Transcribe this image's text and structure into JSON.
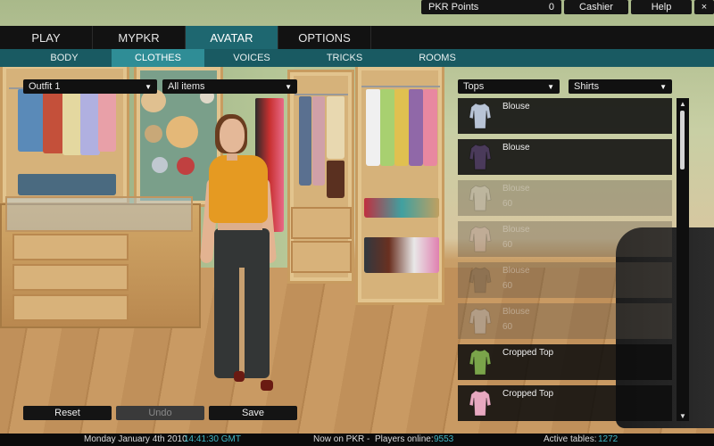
{
  "topbar": {
    "points_label": "PKR Points",
    "points_value": "0",
    "cashier_label": "Cashier",
    "help_label": "Help",
    "close_symbol": "×"
  },
  "main_tabs": [
    "PLAY",
    "MYPKR",
    "AVATAR",
    "OPTIONS"
  ],
  "active_main_tab": "AVATAR",
  "sub_tabs": [
    "BODY",
    "CLOTHES",
    "VOICES",
    "TRICKS",
    "ROOMS"
  ],
  "active_sub_tab": "CLOTHES",
  "filters": {
    "outfit": "Outfit 1",
    "items": "All items",
    "category": "Tops",
    "subcategory": "Shirts"
  },
  "items": [
    {
      "name": "Blouse",
      "price": "",
      "color": "#b8c4d6",
      "locked": false
    },
    {
      "name": "Blouse",
      "price": "",
      "color": "#4a3a5a",
      "locked": false
    },
    {
      "name": "Blouse",
      "price": "60",
      "color": "#e8e0d4",
      "locked": true
    },
    {
      "name": "Blouse",
      "price": "60",
      "color": "#e8c8c0",
      "locked": true
    },
    {
      "name": "Blouse",
      "price": "60",
      "color": "#6a5a48",
      "locked": true
    },
    {
      "name": "Blouse",
      "price": "60",
      "color": "#d0d4dc",
      "locked": true
    },
    {
      "name": "Cropped Top",
      "price": "",
      "color": "#7aa44a",
      "locked": false
    },
    {
      "name": "Cropped Top",
      "price": "",
      "color": "#e8a8c0",
      "locked": false
    }
  ],
  "buttons": {
    "reset": "Reset",
    "undo": "Undo",
    "save": "Save"
  },
  "status": {
    "date": "Monday January 4th 2010",
    "time": "14:41:30 GMT",
    "now_on": "Now on PKR -",
    "players_label": "Players online:",
    "players_value": "9553",
    "tables_label": "Active tables:",
    "tables_value": "1272"
  },
  "icons": {
    "dropdown": "chevron-down-icon",
    "scroll_up": "scroll-up-arrow-icon",
    "scroll_down": "scroll-down-arrow-icon",
    "item_thumb": "shirt-icon"
  },
  "colors": {
    "accent": "#1e6770",
    "accent_light": "#2f8d96",
    "time": "#3fb6c4"
  }
}
